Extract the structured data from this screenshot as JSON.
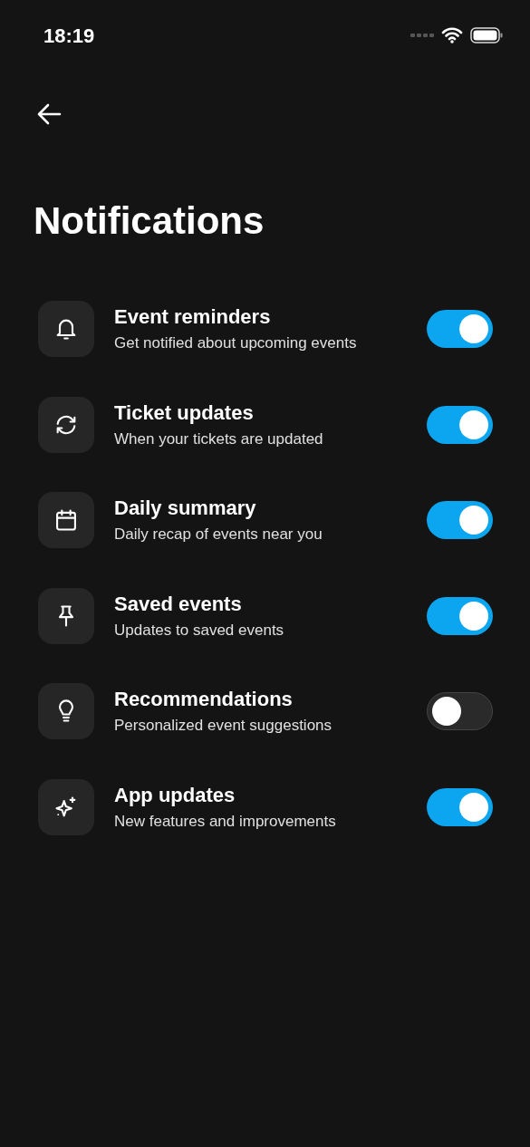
{
  "status_bar": {
    "time": "18:19"
  },
  "title": "Notifications",
  "settings": [
    {
      "title": "Event reminders",
      "subtitle": "Get notified about upcoming events",
      "on": true
    },
    {
      "title": "Ticket updates",
      "subtitle": "When your tickets are updated",
      "on": true
    },
    {
      "title": "Daily summary",
      "subtitle": "Daily recap of events near you",
      "on": true
    },
    {
      "title": "Saved events",
      "subtitle": "Updates to saved events",
      "on": true
    },
    {
      "title": "Recommendations",
      "subtitle": "Personalized event suggestions",
      "on": false
    },
    {
      "title": "App updates",
      "subtitle": "New features and improvements",
      "on": true
    }
  ]
}
